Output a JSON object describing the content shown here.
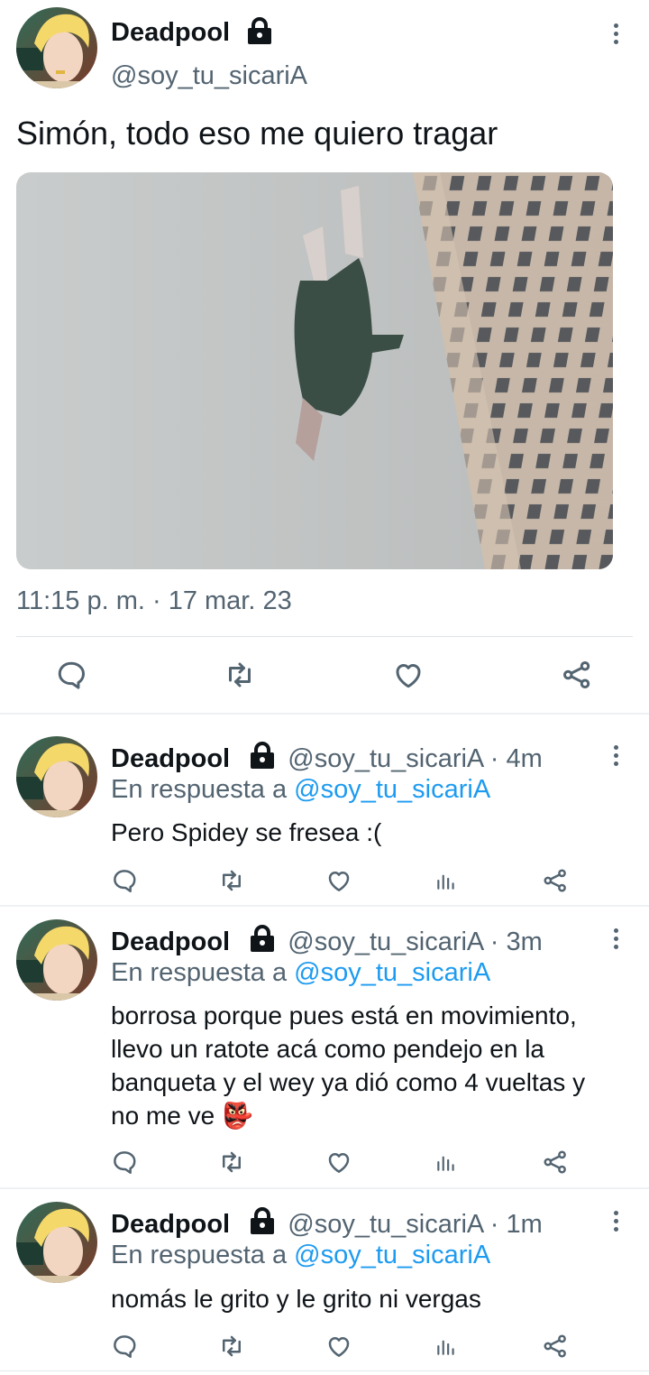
{
  "main_tweet": {
    "display_name": "Deadpool",
    "handle": "@soy_tu_sicariA",
    "text": "Simón, todo eso me quiero tragar",
    "timestamp": "11:15 p. m. · 17 mar. 23",
    "icons": [
      "lock-icon",
      "more-icon",
      "reply-icon",
      "retweet-icon",
      "like-icon",
      "share-icon"
    ]
  },
  "reply_prefix": "En respuesta a",
  "replies": [
    {
      "display_name": "Deadpool",
      "handle": "@soy_tu_sicariA",
      "time": "· 4m",
      "reply_to": "@soy_tu_sicariA",
      "text": "Pero Spidey se fresea :("
    },
    {
      "display_name": "Deadpool",
      "handle": "@soy_tu_sicariA",
      "time": "· 3m",
      "reply_to": "@soy_tu_sicariA",
      "text": "borrosa porque pues está en movimiento, llevo un ratote acá como pendejo en la banqueta y el wey ya dió como 4 vueltas y no me ve 👺"
    },
    {
      "display_name": "Deadpool",
      "handle": "@soy_tu_sicariA",
      "time": "· 1m",
      "reply_to": "@soy_tu_sicariA",
      "text": "nomás le grito y le grito ni vergas"
    }
  ],
  "colors": {
    "link": "#1d9bf0",
    "secondary_text": "#536471",
    "primary_text": "#0f1419"
  }
}
